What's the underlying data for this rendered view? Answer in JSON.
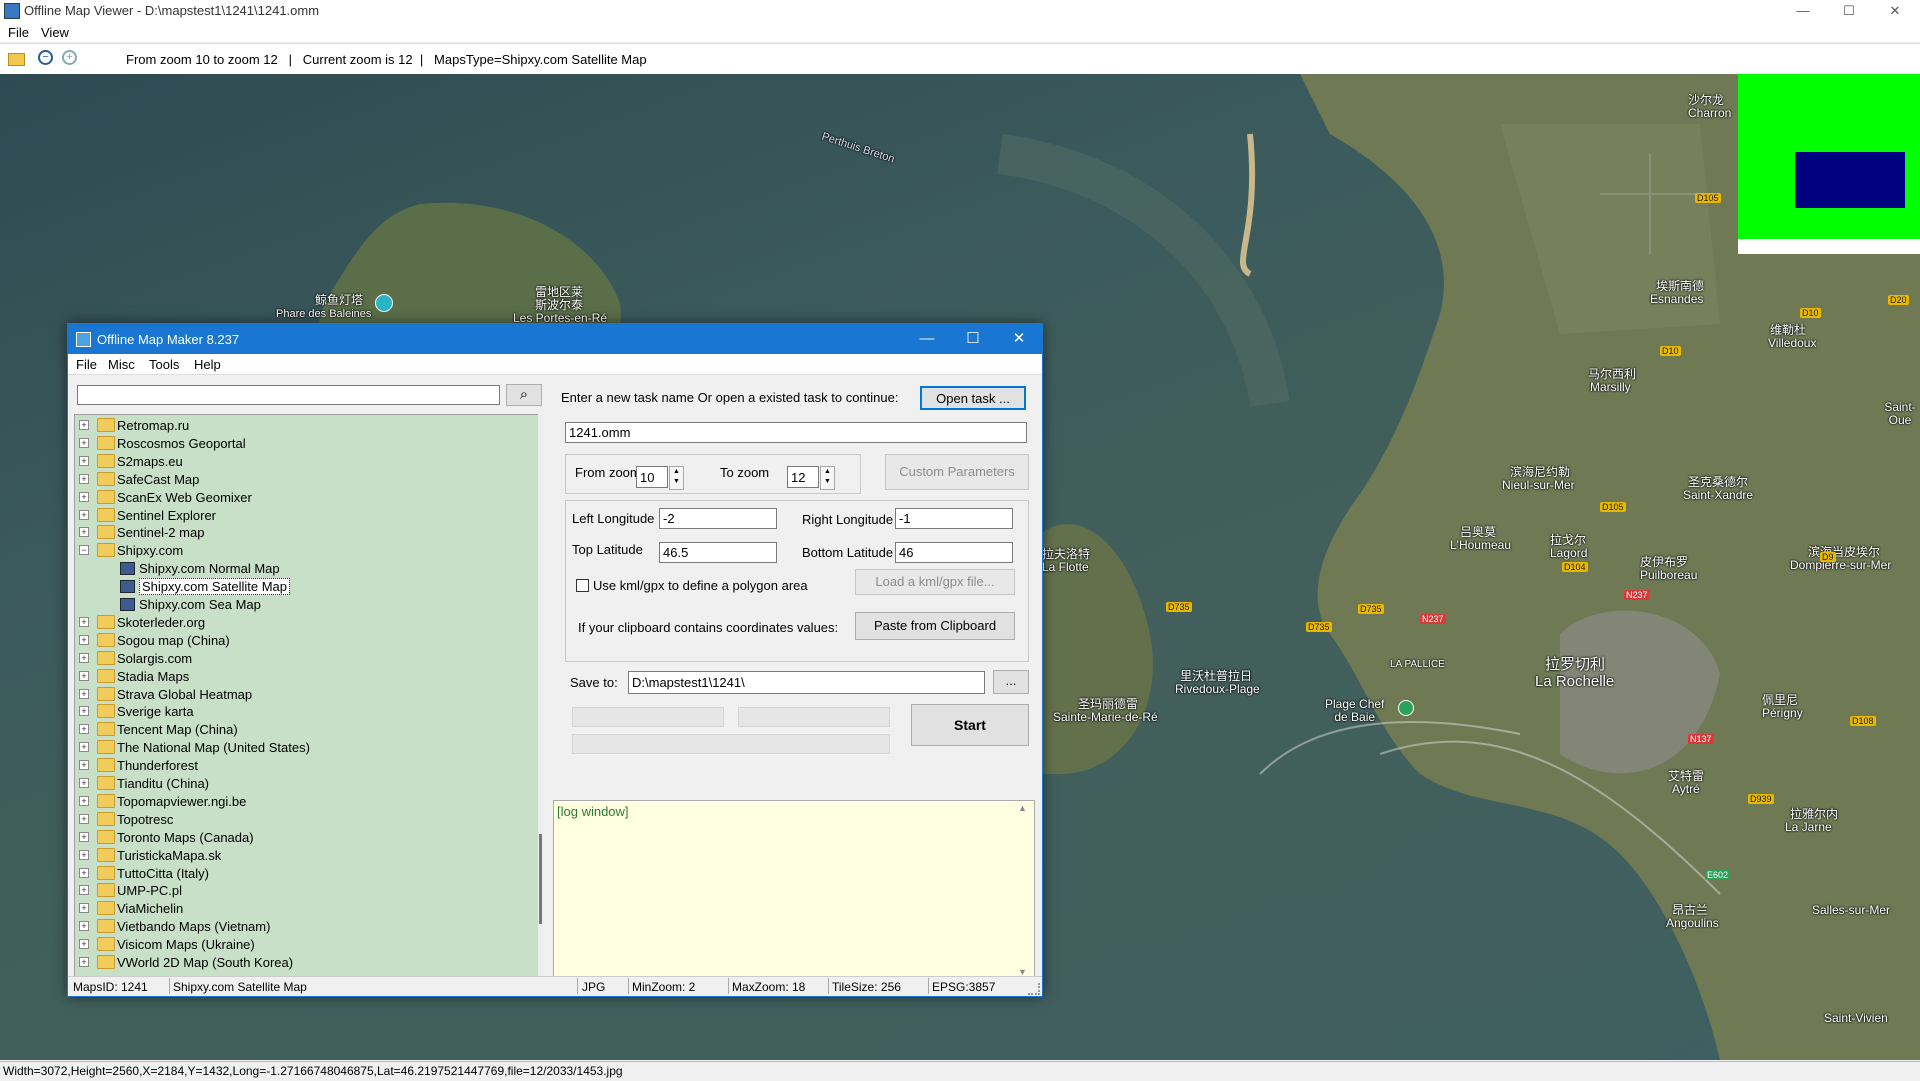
{
  "window": {
    "title": "Offline Map Viewer - D:\\mapstest1\\1241\\1241.omm",
    "menu": [
      "File",
      "View"
    ],
    "controls": {
      "minimize": "—",
      "maximize": "☐",
      "close": "✕"
    }
  },
  "toolbar": {
    "info": "From zoom 10 to zoom 12   |   Current zoom is 12  |   MapsType=Shipxy.com Satellite Map",
    "icons": [
      "open-folder-icon",
      "zoom-out-icon",
      "zoom-in-icon"
    ]
  },
  "map": {
    "labels": {
      "perthuis": "Perthuis Breton",
      "baleines_cn": "鲸鱼灯塔",
      "baleines": "Phare des Baleines",
      "portes_cn": "雷地区莱\n斯波尔泰",
      "portes": "Les Portes-en-Ré",
      "charron_cn": "沙尔龙",
      "charron": "Charron",
      "esnandes_cn": "埃斯南德",
      "esnandes": "Esnandes",
      "villedoux_cn": "维勒杜",
      "villedoux": "Villedoux",
      "marsilly_cn": "马尔西利",
      "marsilly": "Marsilly",
      "saintouen": "Saint-Oue",
      "nieul_cn": "滨海尼约勒",
      "nieul": "Nieul-sur-Mer",
      "xandre_cn": "圣克桑德尔",
      "xandre": "Saint-Xandre",
      "houmeau_cn": "吕奥莫",
      "houmeau": "L'Houmeau",
      "lagord_cn": "拉戈尔",
      "lagord": "Lagord",
      "puilboreau_cn": "皮伊布罗",
      "puilboreau": "Puilboreau",
      "dompierre_cn": "滨海当皮埃尔",
      "dompierre": "Dompierre-sur-Mer",
      "flotte_cn": "拉夫洛特",
      "flotte": "La Flotte",
      "rivedoux_cn": "里沃杜普拉日",
      "rivedoux": "Rivedoux-Plage",
      "marie_cn": "圣玛丽德雷",
      "marie": "Sainte-Marie-de-Ré",
      "pallice": "LA PALLICE",
      "rochelle_cn": "拉罗切利",
      "rochelle": "La Rochelle",
      "chefbaie": "Plage Chef\nde Baie",
      "perigny_cn": "佩里尼",
      "perigny": "Périgny",
      "aytre_cn": "艾特雷",
      "aytre": "Aytré",
      "jarne_cn": "拉雅尔内",
      "jarne": "La Jarne",
      "angoulins_cn": "昂古兰",
      "angoulins": "Angoulins",
      "salles": "Salles-sur-Mer",
      "vivien": "Saint-Vivien"
    },
    "roads": [
      "D105",
      "D10",
      "D10",
      "D105",
      "D104",
      "D735",
      "D735",
      "D735",
      "N237",
      "N237",
      "N137",
      "D9",
      "D939",
      "E602",
      "D108",
      "D20"
    ]
  },
  "minimap": {
    "bg": "#00ff00",
    "viewport": "#000080"
  },
  "status": "Width=3072,Height=2560,X=2184,Y=1432,Long=-1.27166748046875,Lat=46.2197521447769,file=12/2033/1453.jpg",
  "dialog": {
    "title": "Offline Map Maker 8.237",
    "menu": [
      "File",
      "Misc",
      "Tools",
      "Help"
    ],
    "search": {
      "value": "",
      "button": "⌕"
    },
    "tree": [
      {
        "label": "Retromap.ru",
        "type": "folder"
      },
      {
        "label": "Roscosmos Geoportal",
        "type": "folder"
      },
      {
        "label": "S2maps.eu",
        "type": "folder"
      },
      {
        "label": "SafeCast Map",
        "type": "folder"
      },
      {
        "label": "ScanEx Web Geomixer",
        "type": "folder"
      },
      {
        "label": "Sentinel Explorer",
        "type": "folder"
      },
      {
        "label": "Sentinel-2 map",
        "type": "folder"
      },
      {
        "label": "Shipxy.com",
        "type": "open"
      },
      {
        "label": "Shipxy.com Normal Map",
        "type": "child"
      },
      {
        "label": "Shipxy.com Satellite Map",
        "type": "child",
        "selected": true
      },
      {
        "label": "Shipxy.com Sea Map",
        "type": "child"
      },
      {
        "label": "Skoterleder.org",
        "type": "folder"
      },
      {
        "label": "Sogou map (China)",
        "type": "folder"
      },
      {
        "label": "Solargis.com",
        "type": "folder"
      },
      {
        "label": "Stadia Maps",
        "type": "folder"
      },
      {
        "label": "Strava Global Heatmap",
        "type": "folder"
      },
      {
        "label": "Sverige karta",
        "type": "folder"
      },
      {
        "label": "Tencent Map (China)",
        "type": "folder"
      },
      {
        "label": "The National Map (United States)",
        "type": "folder"
      },
      {
        "label": "Thunderforest",
        "type": "folder"
      },
      {
        "label": "Tianditu (China)",
        "type": "folder"
      },
      {
        "label": "Topomapviewer.ngi.be",
        "type": "folder"
      },
      {
        "label": "Topotresc",
        "type": "folder"
      },
      {
        "label": "Toronto Maps (Canada)",
        "type": "folder"
      },
      {
        "label": "TuristickaMapa.sk",
        "type": "folder"
      },
      {
        "label": "TuttoCitta (Italy)",
        "type": "folder"
      },
      {
        "label": "UMP-PC.pl",
        "type": "folder"
      },
      {
        "label": "ViaMichelin",
        "type": "folder"
      },
      {
        "label": "Vietbando Maps (Vietnam)",
        "type": "folder"
      },
      {
        "label": "Visicom Maps (Ukraine)",
        "type": "folder"
      },
      {
        "label": "VWorld 2D Map (South Korea)",
        "type": "folder"
      }
    ],
    "task_prompt": "Enter a new task name Or open a existed task to continue:",
    "open_task": "Open task ...",
    "task_name": "1241.omm",
    "from_zoom_label": "From zoom",
    "from_zoom": "10",
    "to_zoom_label": "To zoom",
    "to_zoom": "12",
    "custom_params": "Custom Parameters",
    "left_lon_label": "Left Longitude",
    "left_lon": "-2",
    "right_lon_label": "Right Longitude",
    "right_lon": "-1",
    "top_lat_label": "Top Latitude",
    "top_lat": "46.5",
    "bottom_lat_label": "Bottom Latitude",
    "bottom_lat": "46",
    "kml_check": "Use kml/gpx to define a polygon area",
    "load_kml": "Load a kml/gpx file...",
    "clipboard_label": "If your clipboard contains coordinates values:",
    "paste": "Paste from Clipboard",
    "save_label": "Save to:",
    "save_path": "D:\\mapstest1\\1241\\",
    "browse": "...",
    "start": "Start",
    "log": "[log window]",
    "status": {
      "mapsid": "MapsID: 1241",
      "name": "Shipxy.com Satellite Map",
      "fmt": "JPG",
      "minzoom": "MinZoom: 2",
      "maxzoom": "MaxZoom: 18",
      "tilesize": "TileSize: 256",
      "epsg": "EPSG:3857"
    }
  }
}
